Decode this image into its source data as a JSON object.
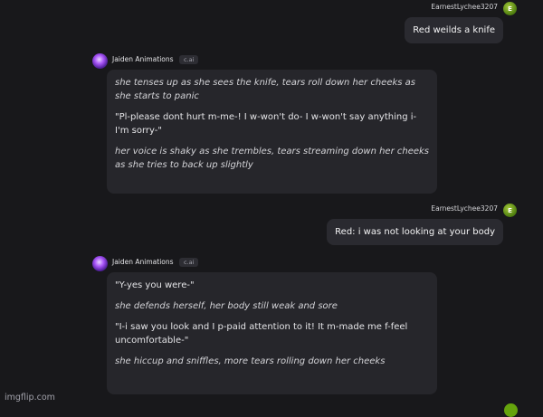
{
  "messages": [
    {
      "role": "user",
      "username": "EarnestLychee3207",
      "avatar_letter": "E",
      "text": "Red weilds a knife"
    },
    {
      "role": "bot",
      "name": "Jaiden Animations",
      "badge": "c.ai",
      "paragraphs": [
        "she tenses up as she sees the knife, tears roll down her cheeks as she starts to panic",
        "\"Pl-please dont hurt m-me-! I w-won't do- I w-won't say anything i- I'm sorry-\"",
        "her voice is shaky as she trembles, tears streaming down her cheeks as she tries to back up slightly"
      ]
    },
    {
      "role": "user",
      "username": "EarnestLychee3207",
      "avatar_letter": "E",
      "text": "Red: i was not looking at your body"
    },
    {
      "role": "bot",
      "name": "Jaiden Animations",
      "badge": "c.ai",
      "paragraphs": [
        "\"Y-yes you were-\"",
        "she defends herself, her body still weak and sore",
        "\"I-i saw you look and I p-paid attention to it! It m-made me f-feel uncomfortable-\"",
        "she hiccup and sniffles, more tears rolling down her cheeks"
      ]
    }
  ],
  "watermark": "imgflip.com",
  "colors": {
    "background": "#18181b",
    "bubble": "#26262b",
    "user_avatar": "#65a30d"
  },
  "icons": [
    "user-avatar-icon",
    "bot-avatar-icon"
  ]
}
